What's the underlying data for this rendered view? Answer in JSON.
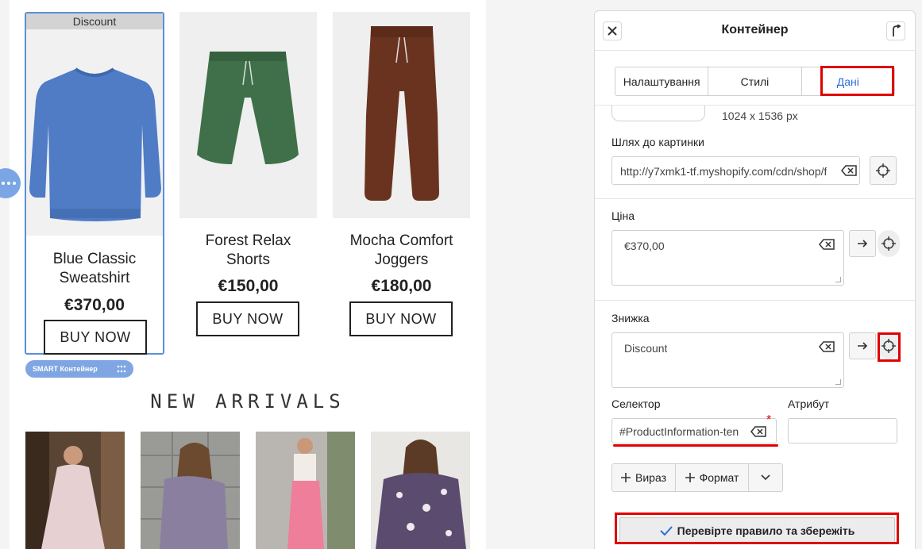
{
  "canvas": {
    "products": [
      {
        "badge": "Discount",
        "name_line1": "Blue Classic",
        "name_line2": "Sweatshirt",
        "price": "€370,00",
        "button": "BUY NOW",
        "color": "#4f7cc5"
      },
      {
        "name_line1": "Forest Relax",
        "name_line2": "Shorts",
        "price": "€150,00",
        "button": "BUY NOW",
        "color": "#3f7049"
      },
      {
        "name_line1": "Mocha Comfort",
        "name_line2": "Joggers",
        "price": "€180,00",
        "button": "BUY NOW",
        "color": "#6a3320"
      }
    ],
    "smart_tag": "SMART Контейнер",
    "section_title": "NEW ARRIVALS"
  },
  "panel": {
    "title": "Контейнер",
    "tabs": [
      "Налаштування",
      "Стилі",
      "Дані"
    ],
    "active_tab": "Дані",
    "image_dims": "1024 x 1536 px",
    "image_path_label": "Шлях до картинки",
    "image_path_value": "http://y7xmk1-tf.myshopify.com/cdn/shop/f",
    "price_label": "Ціна",
    "price_value": "€370,00",
    "discount_label": "Знижка",
    "discount_value": "Discount",
    "selector_label": "Селектор",
    "selector_value": "#ProductInformation-ten",
    "attribute_label": "Атрибут",
    "attribute_value": "",
    "required_mark": "*",
    "expression_btn": "Вираз",
    "format_btn": "Формат",
    "save_btn": "Перевірте правило та збережіть"
  },
  "colors": {
    "accent": "#2f6bd8",
    "highlight": "#e00000",
    "selection": "#5b8fd6"
  }
}
